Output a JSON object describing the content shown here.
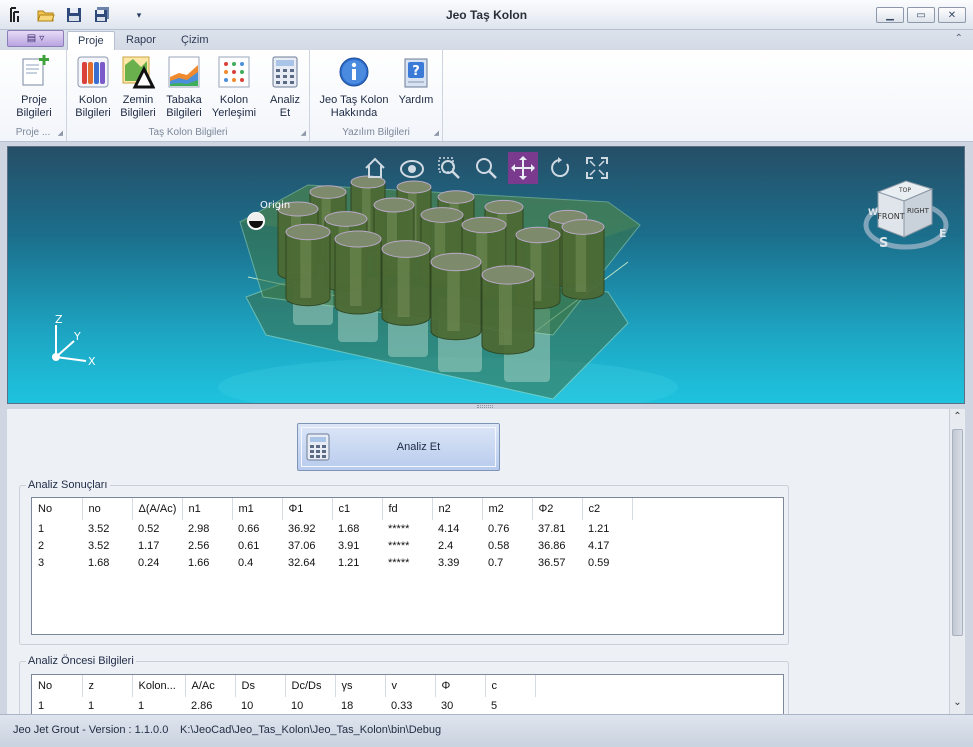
{
  "window": {
    "title": "Jeo Taş Kolon"
  },
  "ribbon": {
    "tabs": [
      {
        "label": "Proje"
      },
      {
        "label": "Rapor"
      },
      {
        "label": "Çizim"
      }
    ],
    "groups": [
      {
        "label": "Proje ..."
      },
      {
        "label": "Taş Kolon Bilgileri"
      },
      {
        "label": "Yazılım Bilgileri"
      }
    ],
    "buttons": [
      {
        "line1": "Proje",
        "line2": "Bilgileri"
      },
      {
        "line1": "Kolon",
        "line2": "Bilgileri"
      },
      {
        "line1": "Zemin",
        "line2": "Bilgileri"
      },
      {
        "line1": "Tabaka",
        "line2": "Bilgileri"
      },
      {
        "line1": "Kolon",
        "line2": "Yerleşimi"
      },
      {
        "line1": "Analiz",
        "line2": "Et"
      },
      {
        "line1": "Jeo Taş Kolon",
        "line2": "Hakkında"
      },
      {
        "line1": "Yardım",
        "line2": ""
      }
    ]
  },
  "viewport": {
    "origin_label": "Origin",
    "axes": {
      "x": "X",
      "y": "Y",
      "z": "Z"
    },
    "viewcube": {
      "face": "FRONT",
      "side": "RIGHT",
      "top": "TOP",
      "compass_s": "S",
      "compass_e": "E",
      "compass_w": "W"
    }
  },
  "analyze_button": {
    "label": "Analiz Et"
  },
  "results": {
    "title": "Analiz Sonuçları",
    "columns": [
      "No",
      "no",
      "Δ(A/Ac)",
      "n1",
      "m1",
      "Φ1",
      "c1",
      "fd",
      "n2",
      "m2",
      "Φ2",
      "c2"
    ],
    "rows": [
      [
        "1",
        "3.52",
        "0.52",
        "2.98",
        "0.66",
        "36.92",
        "1.68",
        "*****",
        "4.14",
        "0.76",
        "37.81",
        "1.21"
      ],
      [
        "2",
        "3.52",
        "1.17",
        "2.56",
        "0.61",
        "37.06",
        "3.91",
        "*****",
        "2.4",
        "0.58",
        "36.86",
        "4.17"
      ],
      [
        "3",
        "1.68",
        "0.24",
        "1.66",
        "0.4",
        "32.64",
        "1.21",
        "*****",
        "3.39",
        "0.7",
        "36.57",
        "0.59"
      ]
    ]
  },
  "pre_analysis": {
    "title": "Analiz Öncesi Bilgileri",
    "columns": [
      "No",
      "z",
      "Kolon...",
      "A/Ac",
      "Ds",
      "Dc/Ds",
      "γs",
      "v",
      "Φ",
      "c"
    ],
    "rows": [
      [
        "1",
        "1",
        "1",
        "2.86",
        "10",
        "10",
        "18",
        "0.33",
        "30",
        "5"
      ]
    ]
  },
  "status": {
    "version": "Jeo Jet Grout - Version : 1.1.0.0",
    "path": "K:\\JeoCad\\Jeo_Tas_Kolon\\Jeo_Tas_Kolon\\bin\\Debug"
  },
  "colors": {
    "active_tool": "#7a3a8e",
    "viewport_top": "#264e67",
    "viewport_bottom": "#1ec3de",
    "column_fill": "#4c6a34",
    "block_fill": "#3f7a46"
  }
}
